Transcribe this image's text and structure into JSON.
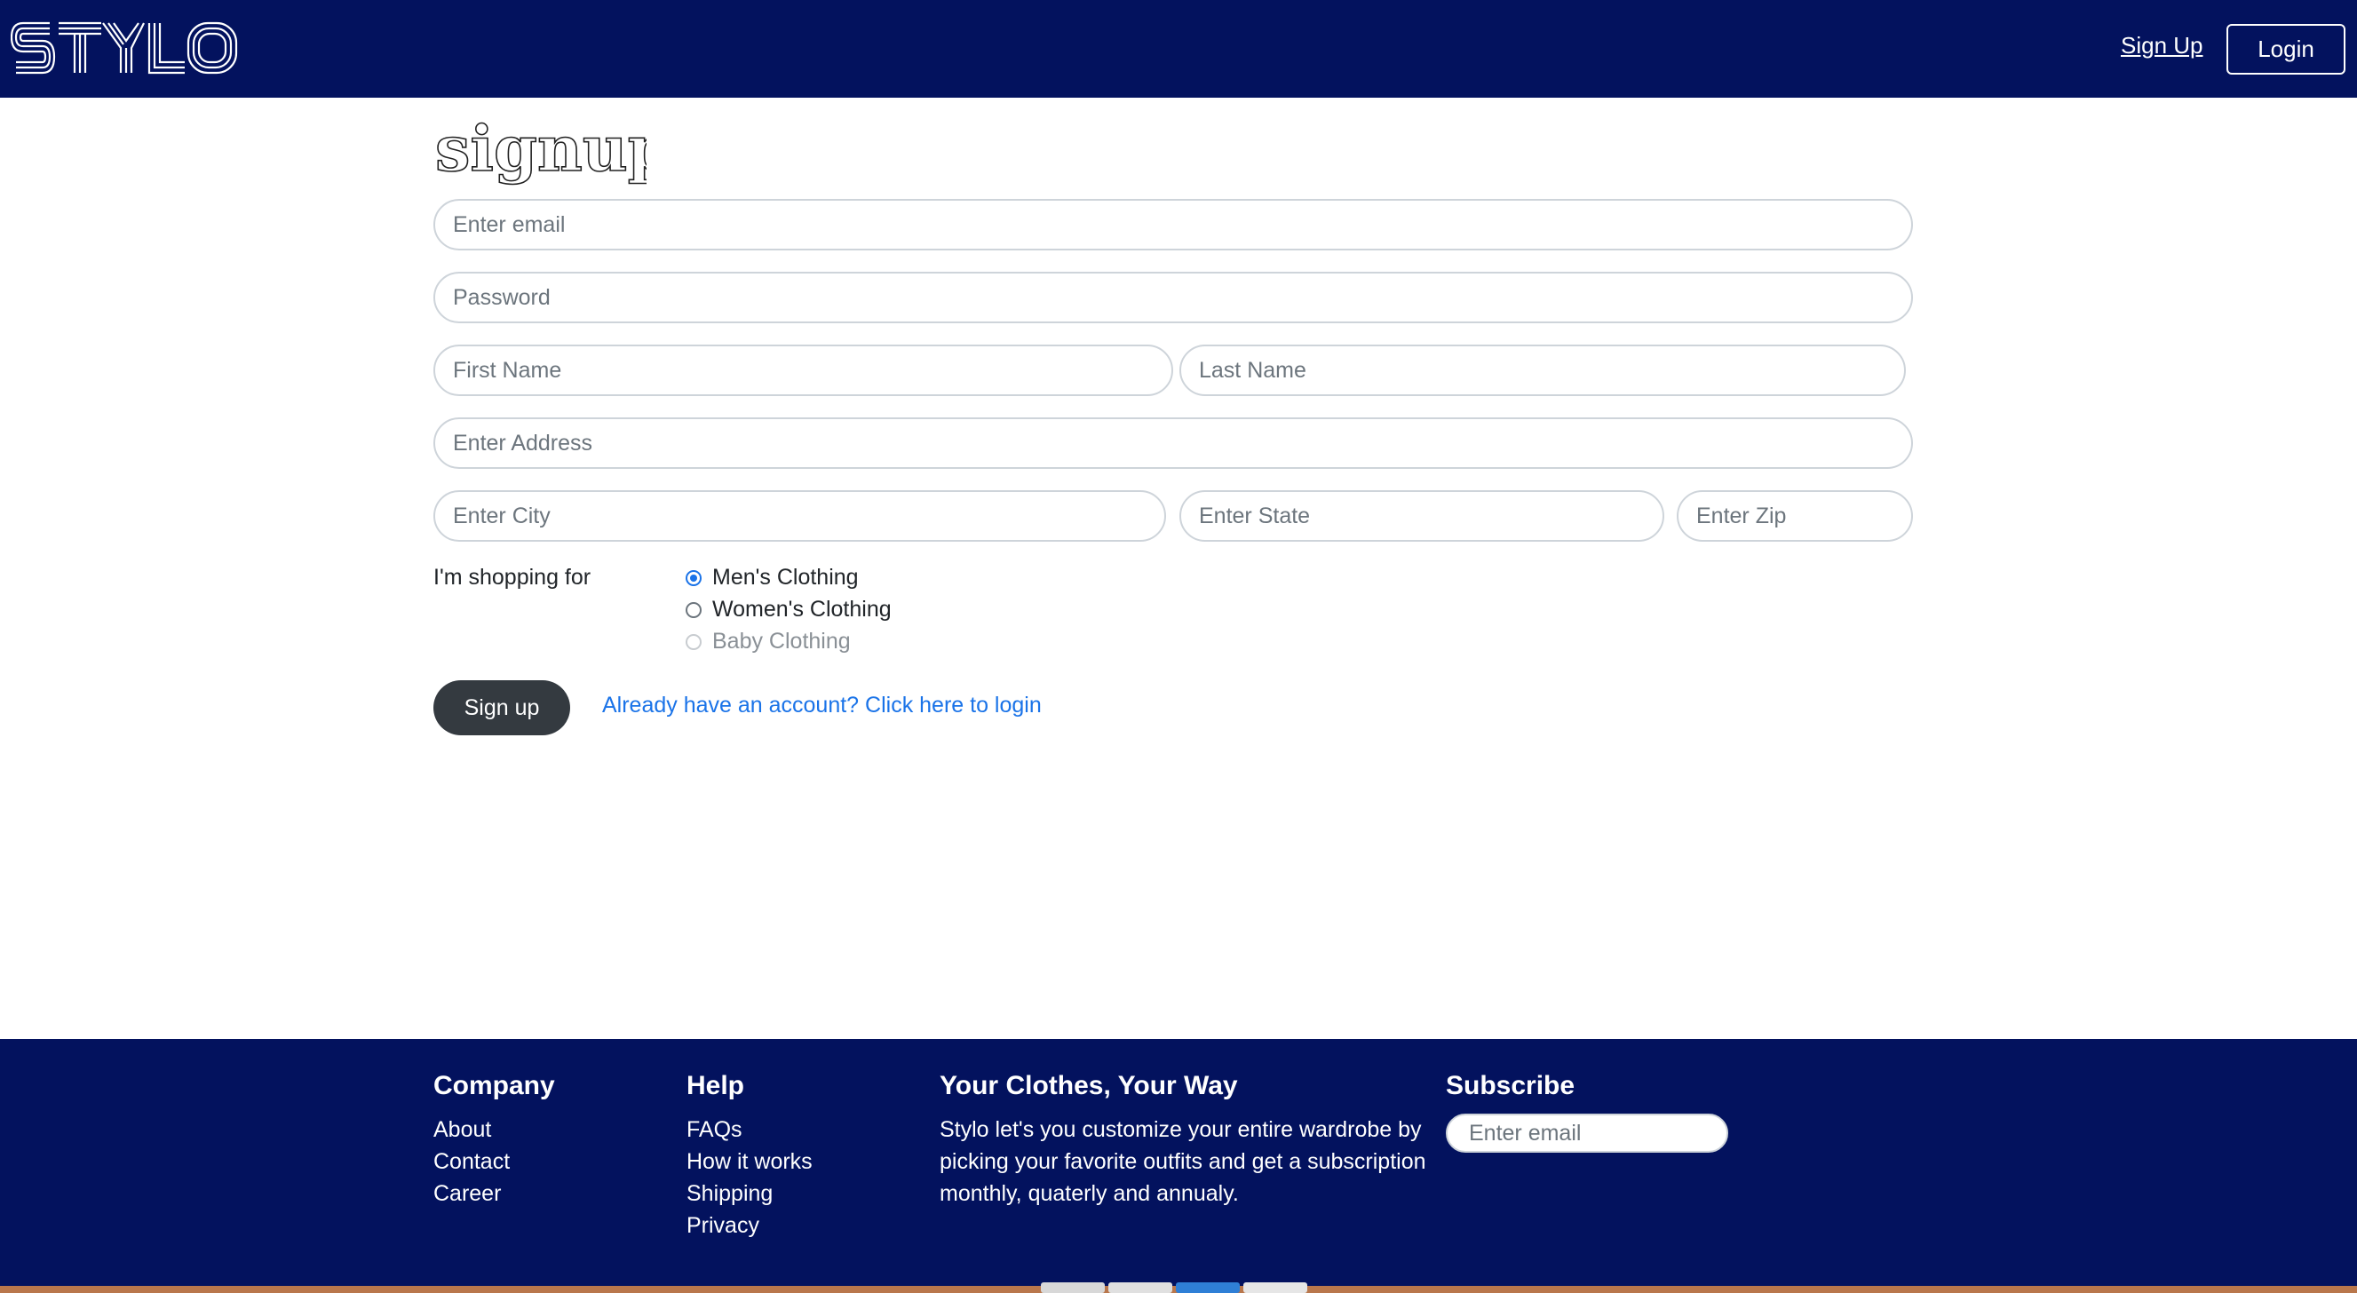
{
  "header": {
    "logo_text": "STYLO",
    "signup_link": "Sign Up",
    "login_button": "Login"
  },
  "form": {
    "title": "signup",
    "email_placeholder": "Enter email",
    "password_placeholder": "Password",
    "first_name_placeholder": "First Name",
    "last_name_placeholder": "Last Name",
    "address_placeholder": "Enter Address",
    "city_placeholder": "Enter City",
    "state_placeholder": "Enter State",
    "zip_placeholder": "Enter Zip",
    "shopping_label": "I'm shopping for",
    "options": [
      {
        "label": "Men's Clothing",
        "checked": true,
        "disabled": false
      },
      {
        "label": "Women's Clothing",
        "checked": false,
        "disabled": false
      },
      {
        "label": "Baby Clothing",
        "checked": false,
        "disabled": true
      }
    ],
    "submit_label": "Sign up",
    "login_link": "Already have an account? Click here to login"
  },
  "footer": {
    "company": {
      "heading": "Company",
      "links": [
        "About",
        "Contact",
        "Career"
      ]
    },
    "help": {
      "heading": "Help",
      "links": [
        "FAQs",
        "How it works",
        "Shipping",
        "Privacy"
      ]
    },
    "about": {
      "heading": "Your Clothes, Your Way",
      "text": "Stylo let's you customize your entire wardrobe by picking your favorite outfits and get a subscription monthly, quaterly and annualy."
    },
    "subscribe": {
      "heading": "Subscribe",
      "placeholder": "Enter email"
    }
  },
  "colors": {
    "navy": "#03125e",
    "primary": "#1a73e8",
    "dark_button": "#343a40"
  }
}
